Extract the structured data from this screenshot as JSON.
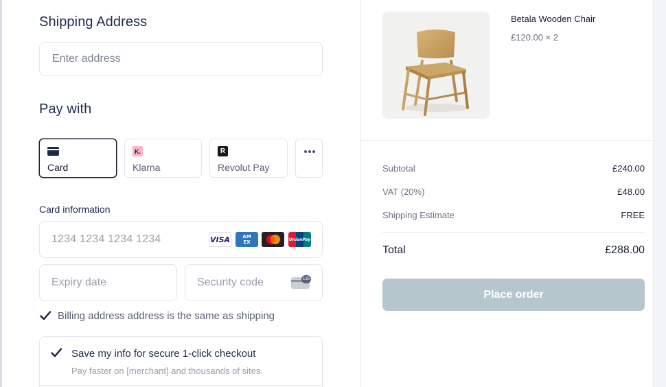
{
  "shipping": {
    "title": "Shipping Address",
    "address_placeholder": "Enter address"
  },
  "pay_with": {
    "title": "Pay with",
    "methods": [
      {
        "label": "Card",
        "selected": true,
        "icon": "card-icon"
      },
      {
        "label": "Klarna",
        "selected": false,
        "icon": "klarna-icon",
        "icon_text": "K."
      },
      {
        "label": "Revolut Pay",
        "selected": false,
        "icon": "revolut-icon",
        "icon_text": "R"
      }
    ],
    "more_icon": "more-dots-icon"
  },
  "card": {
    "section_label": "Card information",
    "number_placeholder": "1234 1234 1234 1234",
    "brands": [
      {
        "name": "visa",
        "text": "VISA",
        "color": "#1a1f71"
      },
      {
        "name": "amex",
        "text": "AM EX",
        "color": "#2e77bb"
      },
      {
        "name": "mastercard",
        "text": "",
        "color": "#222222"
      },
      {
        "name": "unionpay",
        "text": "UnionPay",
        "color": "#00447c"
      }
    ],
    "expiry_placeholder": "Expiry date",
    "cvc_placeholder": "Security code",
    "cvc_icon_text": "135"
  },
  "billing_same": {
    "checked": true,
    "label": "Billing address address is the same as shipping"
  },
  "save_info": {
    "checked": true,
    "title": "Save my info for secure 1-click checkout",
    "subtitle": "Pay faster on [merchant] and thousands of sites."
  },
  "product": {
    "name": "Betala Wooden Chair",
    "price_qty": "£120.00 × 2"
  },
  "summary": {
    "subtotal_label": "Subtotal",
    "subtotal_value": "£240.00",
    "vat_label": "VAT (20%)",
    "vat_value": "£48.00",
    "shipping_label": "Shipping Estimate",
    "shipping_value": "FREE",
    "total_label": "Total",
    "total_value": "£288.00"
  },
  "place_order_label": "Place order",
  "colors": {
    "accent_disabled": "#b6c6cd",
    "text_dark": "#1a1f36",
    "klarna_pink": "#ffb3c7"
  }
}
